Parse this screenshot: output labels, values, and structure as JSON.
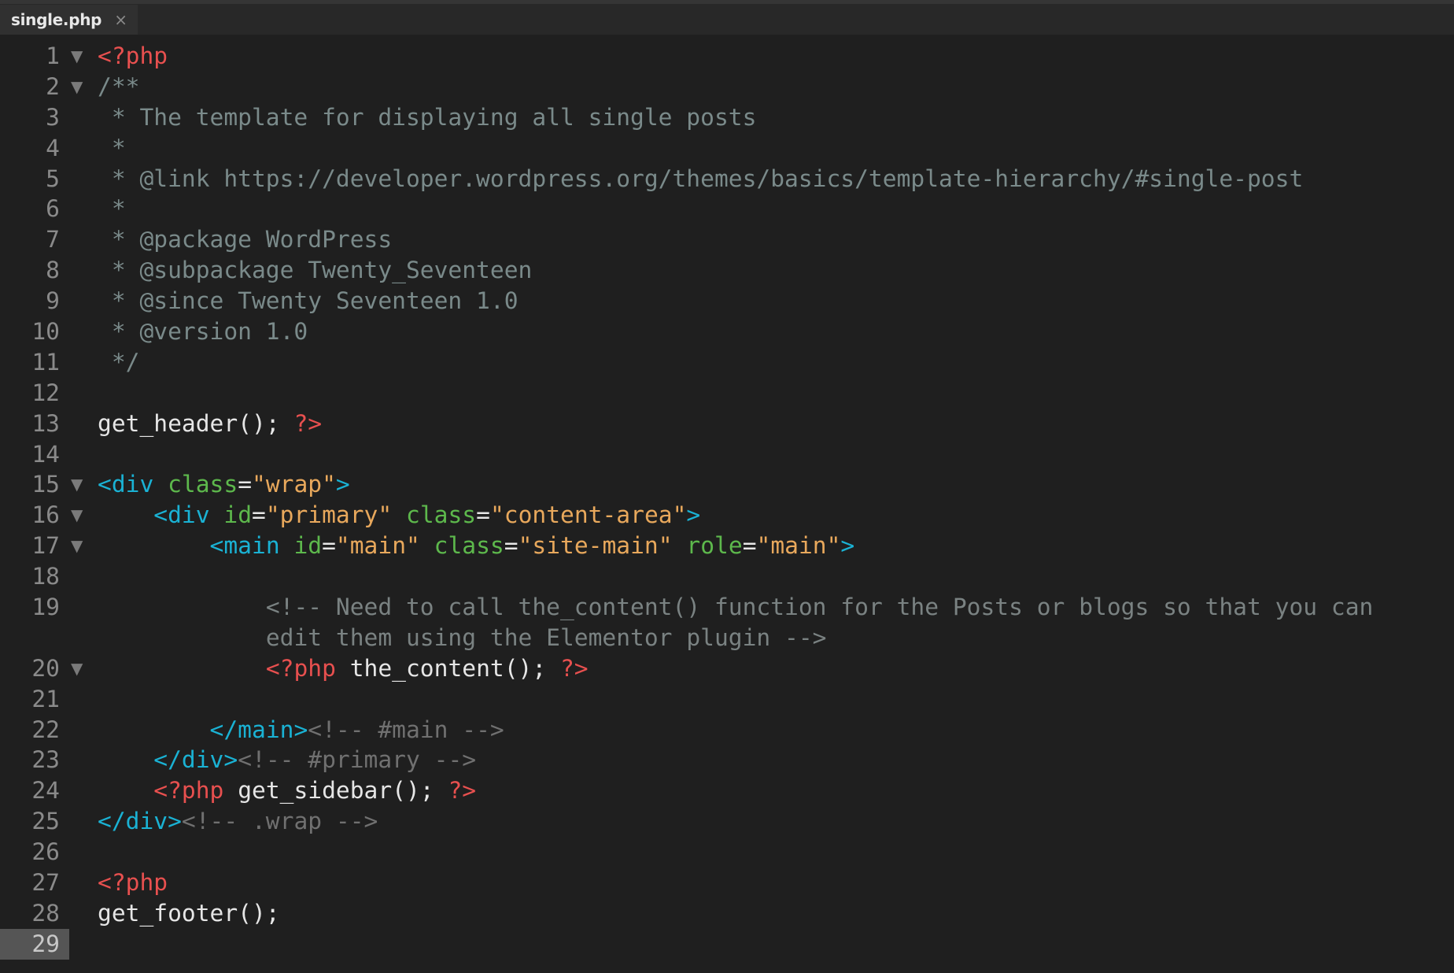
{
  "tab": {
    "label": "single.php",
    "close_icon": "×"
  },
  "fold_icon": "▼",
  "current_line": 29,
  "colors": {
    "php_tag": "#e8504f",
    "doc_comment": "#7a8a8a",
    "html_comment": "#707070",
    "html_tag": "#1ab2d4",
    "attribute": "#5db84c",
    "string": "#e8a85c",
    "plain": "#e6e6e6"
  },
  "lines": [
    {
      "n": "1",
      "fold": true,
      "tokens": [
        [
          "php",
          "<?php"
        ]
      ]
    },
    {
      "n": "2",
      "fold": true,
      "tokens": [
        [
          "doc",
          "/**"
        ]
      ]
    },
    {
      "n": "3",
      "tokens": [
        [
          "doc",
          " * The template for displaying all single posts"
        ]
      ]
    },
    {
      "n": "4",
      "tokens": [
        [
          "doc",
          " *"
        ]
      ]
    },
    {
      "n": "5",
      "tokens": [
        [
          "doc",
          " * @link https://developer.wordpress.org/themes/basics/template-hierarchy/#single-post"
        ]
      ]
    },
    {
      "n": "6",
      "tokens": [
        [
          "doc",
          " *"
        ]
      ]
    },
    {
      "n": "7",
      "tokens": [
        [
          "doc",
          " * @package WordPress"
        ]
      ]
    },
    {
      "n": "8",
      "tokens": [
        [
          "doc",
          " * @subpackage Twenty_Seventeen"
        ]
      ]
    },
    {
      "n": "9",
      "tokens": [
        [
          "doc",
          " * @since Twenty Seventeen 1.0"
        ]
      ]
    },
    {
      "n": "10",
      "tokens": [
        [
          "doc",
          " * @version 1.0"
        ]
      ]
    },
    {
      "n": "11",
      "tokens": [
        [
          "doc",
          " */"
        ]
      ]
    },
    {
      "n": "12",
      "tokens": []
    },
    {
      "n": "13",
      "tokens": [
        [
          "plain",
          "get_header(); "
        ],
        [
          "php",
          "?>"
        ]
      ]
    },
    {
      "n": "14",
      "tokens": []
    },
    {
      "n": "15",
      "fold": true,
      "tokens": [
        [
          "tag",
          "<div "
        ],
        [
          "attr",
          "class"
        ],
        [
          "plain",
          "="
        ],
        [
          "str",
          "\"wrap\""
        ],
        [
          "tag",
          ">"
        ]
      ]
    },
    {
      "n": "16",
      "fold": true,
      "tokens": [
        [
          "plain",
          "    "
        ],
        [
          "tag",
          "<div "
        ],
        [
          "attr",
          "id"
        ],
        [
          "plain",
          "="
        ],
        [
          "str",
          "\"primary\""
        ],
        [
          "plain",
          " "
        ],
        [
          "attr",
          "class"
        ],
        [
          "plain",
          "="
        ],
        [
          "str",
          "\"content-area\""
        ],
        [
          "tag",
          ">"
        ]
      ]
    },
    {
      "n": "17",
      "fold": true,
      "tokens": [
        [
          "plain",
          "        "
        ],
        [
          "tag",
          "<main "
        ],
        [
          "attr",
          "id"
        ],
        [
          "plain",
          "="
        ],
        [
          "str",
          "\"main\""
        ],
        [
          "plain",
          " "
        ],
        [
          "attr",
          "class"
        ],
        [
          "plain",
          "="
        ],
        [
          "str",
          "\"site-main\""
        ],
        [
          "plain",
          " "
        ],
        [
          "attr",
          "role"
        ],
        [
          "plain",
          "="
        ],
        [
          "str",
          "\"main\""
        ],
        [
          "tag",
          ">"
        ]
      ]
    },
    {
      "n": "18",
      "tokens": []
    },
    {
      "n": "19",
      "tokens": [
        [
          "plain",
          "            "
        ],
        [
          "hcmt",
          "<!-- Need to call the_content() function for the Posts or blogs so that you can"
        ]
      ]
    },
    {
      "n": "",
      "tokens": [
        [
          "plain",
          "            "
        ],
        [
          "hcmt",
          "edit them using the Elementor plugin -->"
        ]
      ]
    },
    {
      "n": "20",
      "fold": true,
      "tokens": [
        [
          "plain",
          "            "
        ],
        [
          "php",
          "<?php"
        ],
        [
          "plain",
          " the_content(); "
        ],
        [
          "php",
          "?>"
        ]
      ]
    },
    {
      "n": "21",
      "tokens": []
    },
    {
      "n": "22",
      "tokens": [
        [
          "plain",
          "        "
        ],
        [
          "tag",
          "</main>"
        ],
        [
          "cmt",
          "<!-- #main -->"
        ]
      ]
    },
    {
      "n": "23",
      "tokens": [
        [
          "plain",
          "    "
        ],
        [
          "tag",
          "</div>"
        ],
        [
          "cmt",
          "<!-- #primary -->"
        ]
      ]
    },
    {
      "n": "24",
      "tokens": [
        [
          "plain",
          "    "
        ],
        [
          "php",
          "<?php"
        ],
        [
          "plain",
          " get_sidebar(); "
        ],
        [
          "php",
          "?>"
        ]
      ]
    },
    {
      "n": "25",
      "tokens": [
        [
          "tag",
          "</div>"
        ],
        [
          "cmt",
          "<!-- .wrap -->"
        ]
      ]
    },
    {
      "n": "26",
      "tokens": []
    },
    {
      "n": "27",
      "tokens": [
        [
          "php",
          "<?php"
        ]
      ]
    },
    {
      "n": "28",
      "tokens": [
        [
          "plain",
          "get_footer();"
        ]
      ]
    },
    {
      "n": "29",
      "tokens": []
    }
  ]
}
